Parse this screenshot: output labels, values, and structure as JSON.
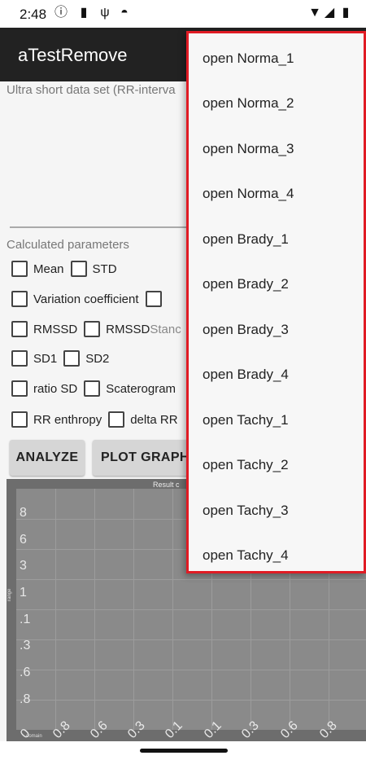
{
  "status_bar": {
    "time": "2:48",
    "icons": [
      "info-icon",
      "sd-card-icon",
      "usb-icon",
      "circle-icon",
      "wifi-icon",
      "signal-icon",
      "battery-icon"
    ]
  },
  "app_bar": {
    "title": "aTestRemove"
  },
  "data_input": {
    "hint": "Ultra short data set (RR-interva"
  },
  "params": {
    "label": "Calculated parameters",
    "rows": [
      [
        {
          "label": "Mean"
        },
        {
          "label": "STD"
        }
      ],
      [
        {
          "label": "Variation coefficient"
        },
        {
          "label": ""
        }
      ],
      [
        {
          "label": "RMSSD"
        },
        {
          "label": "RMSSD",
          "extra": "Stanc"
        }
      ],
      [
        {
          "label": "SD1"
        },
        {
          "label": "SD2"
        }
      ],
      [
        {
          "label": "ratio SD"
        },
        {
          "label": "Scaterogram"
        }
      ],
      [
        {
          "label": "RR enthropy"
        },
        {
          "label": "delta RR"
        }
      ]
    ]
  },
  "buttons": {
    "analyze": "ANALYZE",
    "plot_graphs": "PLOT GRAPHS"
  },
  "graph": {
    "title": "Result c",
    "y_ticks": [
      "8",
      "6",
      "3",
      "1",
      ".1",
      ".3",
      ".6",
      ".8"
    ],
    "x_ticks": [
      "0",
      "0.8",
      "0.6",
      "0.3",
      "0.1",
      "0.1",
      "0.3",
      "0.6",
      "0.8"
    ],
    "y_axis_label": "range",
    "x_axis_label": "domain"
  },
  "menu": {
    "items": [
      "open Norma_1",
      "open Norma_2",
      "open Norma_3",
      "open Norma_4",
      "open Brady_1",
      "open Brady_2",
      "open Brady_3",
      "open Brady_4",
      "open Tachy_1",
      "open Tachy_2",
      "open Tachy_3",
      "open Tachy_4"
    ],
    "border_color": "#e01b24"
  }
}
